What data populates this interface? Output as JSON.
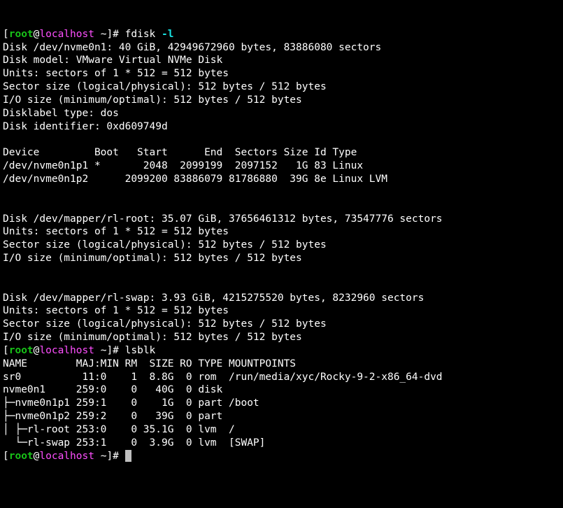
{
  "prompt1": {
    "open": "[",
    "user": "root",
    "at": "@",
    "host": "localhost",
    "tilde": " ~",
    "close": "]# ",
    "cmd": "fdisk ",
    "arg": "-l"
  },
  "disk1": {
    "l1": "Disk /dev/nvme0n1: 40 GiB, 42949672960 bytes, 83886080 sectors",
    "l2": "Disk model: VMware Virtual NVMe Disk",
    "l3": "Units: sectors of 1 * 512 = 512 bytes",
    "l4": "Sector size (logical/physical): 512 bytes / 512 bytes",
    "l5": "I/O size (minimum/optimal): 512 bytes / 512 bytes",
    "l6": "Disklabel type: dos",
    "l7": "Disk identifier: 0xd609749d"
  },
  "ptable": {
    "hdr": "Device         Boot   Start      End  Sectors Size Id Type",
    "r1": "/dev/nvme0n1p1 *       2048  2099199  2097152   1G 83 Linux",
    "r2": "/dev/nvme0n1p2      2099200 83886079 81786880  39G 8e Linux LVM"
  },
  "disk2": {
    "l1": "Disk /dev/mapper/rl-root: 35.07 GiB, 37656461312 bytes, 73547776 sectors",
    "l2": "Units: sectors of 1 * 512 = 512 bytes",
    "l3": "Sector size (logical/physical): 512 bytes / 512 bytes",
    "l4": "I/O size (minimum/optimal): 512 bytes / 512 bytes"
  },
  "disk3": {
    "l1": "Disk /dev/mapper/rl-swap: 3.93 GiB, 4215275520 bytes, 8232960 sectors",
    "l2": "Units: sectors of 1 * 512 = 512 bytes",
    "l3": "Sector size (logical/physical): 512 bytes / 512 bytes",
    "l4": "I/O size (minimum/optimal): 512 bytes / 512 bytes"
  },
  "prompt2": {
    "cmd": "lsblk"
  },
  "lsblk": {
    "hdr": "NAME        MAJ:MIN RM  SIZE RO TYPE MOUNTPOINTS",
    "r1": "sr0          11:0    1  8.8G  0 rom  /run/media/xyc/Rocky-9-2-x86_64-dvd",
    "r2": "nvme0n1     259:0    0   40G  0 disk",
    "r3": "├─nvme0n1p1 259:1    0    1G  0 part /boot",
    "r4": "├─nvme0n1p2 259:2    0   39G  0 part",
    "r5": "│ ├─rl-root 253:0    0 35.1G  0 lvm  /",
    "r6": "  └─rl-swap 253:1    0  3.9G  0 lvm  [SWAP]"
  }
}
